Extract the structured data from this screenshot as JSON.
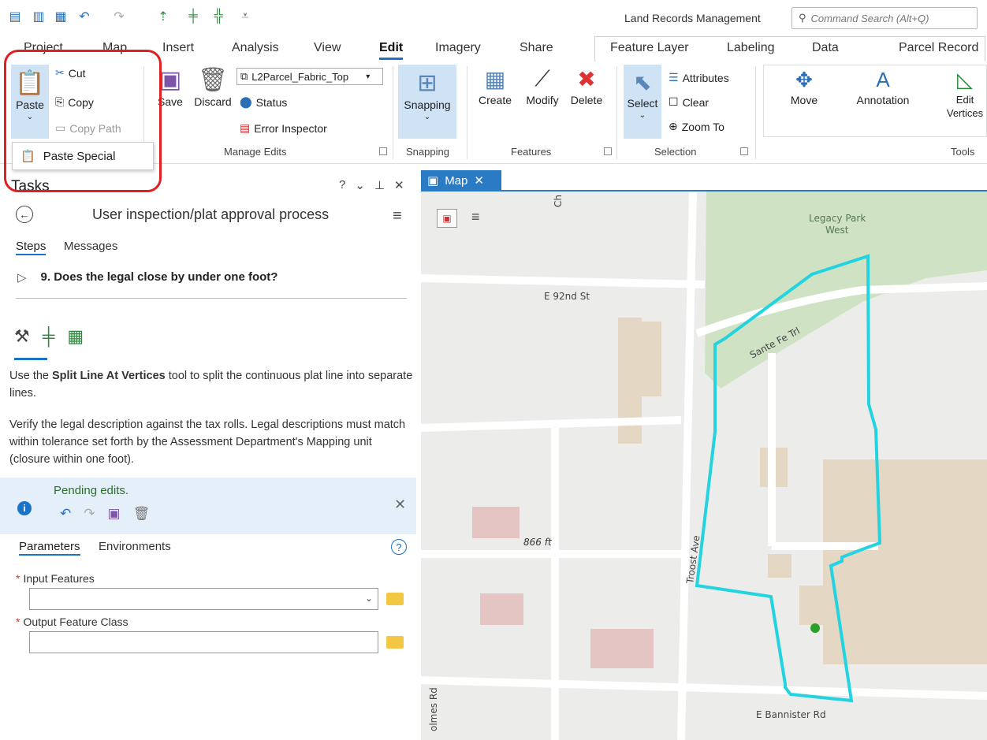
{
  "app": {
    "title": "Land Records Management",
    "command_search_placeholder": "Command Search (Alt+Q)"
  },
  "tabs": {
    "main": [
      "Project",
      "Map",
      "Insert",
      "Analysis",
      "View",
      "Edit",
      "Imagery",
      "Share"
    ],
    "active": "Edit",
    "contextual": [
      "Feature Layer",
      "Labeling",
      "Data",
      "Parcel Record"
    ]
  },
  "ribbon": {
    "clipboard": {
      "paste": "Paste",
      "cut": "Cut",
      "copy": "Copy",
      "copy_path": "Copy Path",
      "paste_special": "Paste Special"
    },
    "manage_edits": {
      "save": "Save",
      "discard": "Discard",
      "layer_dropdown": "L2Parcel_Fabric_Top",
      "status": "Status",
      "error_inspector": "Error Inspector",
      "label": "Manage Edits"
    },
    "snapping": {
      "button": "Snapping",
      "label": "Snapping"
    },
    "features": {
      "create": "Create",
      "modify": "Modify",
      "delete": "Delete",
      "label": "Features"
    },
    "selection": {
      "select": "Select",
      "attributes": "Attributes",
      "clear": "Clear",
      "zoom_to": "Zoom To",
      "label": "Selection"
    },
    "tools": {
      "move": "Move",
      "annotation": "Annotation",
      "edit_vertices_1": "Edit",
      "edit_vertices_2": "Vertices",
      "label": "Tools"
    }
  },
  "tasks": {
    "title": "Tasks",
    "controls": [
      "?",
      "⌄",
      "⊥",
      "✕"
    ],
    "task_name": "User inspection/plat approval process",
    "tab_steps": "Steps",
    "tab_messages": "Messages",
    "step": {
      "toggle": "▷",
      "text": "9.  Does the legal close by under one foot?"
    },
    "instruction_prefix": "Use the ",
    "instruction_tool": "Split Line At Vertices",
    "instruction_suffix": " tool to split the continuous plat line into separate lines.",
    "verify_text": "Verify the legal description against the tax rolls. Legal descriptions must match within tolerance set forth by the Assessment Department's Mapping unit (closure within one foot).",
    "pending": {
      "text": "Pending edits.",
      "close": "✕"
    },
    "tab_parameters": "Parameters",
    "tab_environments": "Environments",
    "input_features_label": "Input Features",
    "output_class_label": "Output Feature Class",
    "input_features_value": "",
    "output_class_value": ""
  },
  "map": {
    "tab_label": "Map",
    "labels": {
      "park": "Legacy Park",
      "park2": "West",
      "street_92": "E 92nd St",
      "trail": "Sante Fe Trl",
      "troost": "Troost Ave",
      "bannister": "E Bannister Rd",
      "elevation": "866 ft",
      "holmes": "olmes Rd",
      "ch": "Ch"
    },
    "colors": {
      "parcel_outline": "#24d3e0",
      "park": "#cfe3c4",
      "road": "#ffffff",
      "building": "#e4d7c4",
      "building_pink": "#e5c5c4"
    }
  }
}
